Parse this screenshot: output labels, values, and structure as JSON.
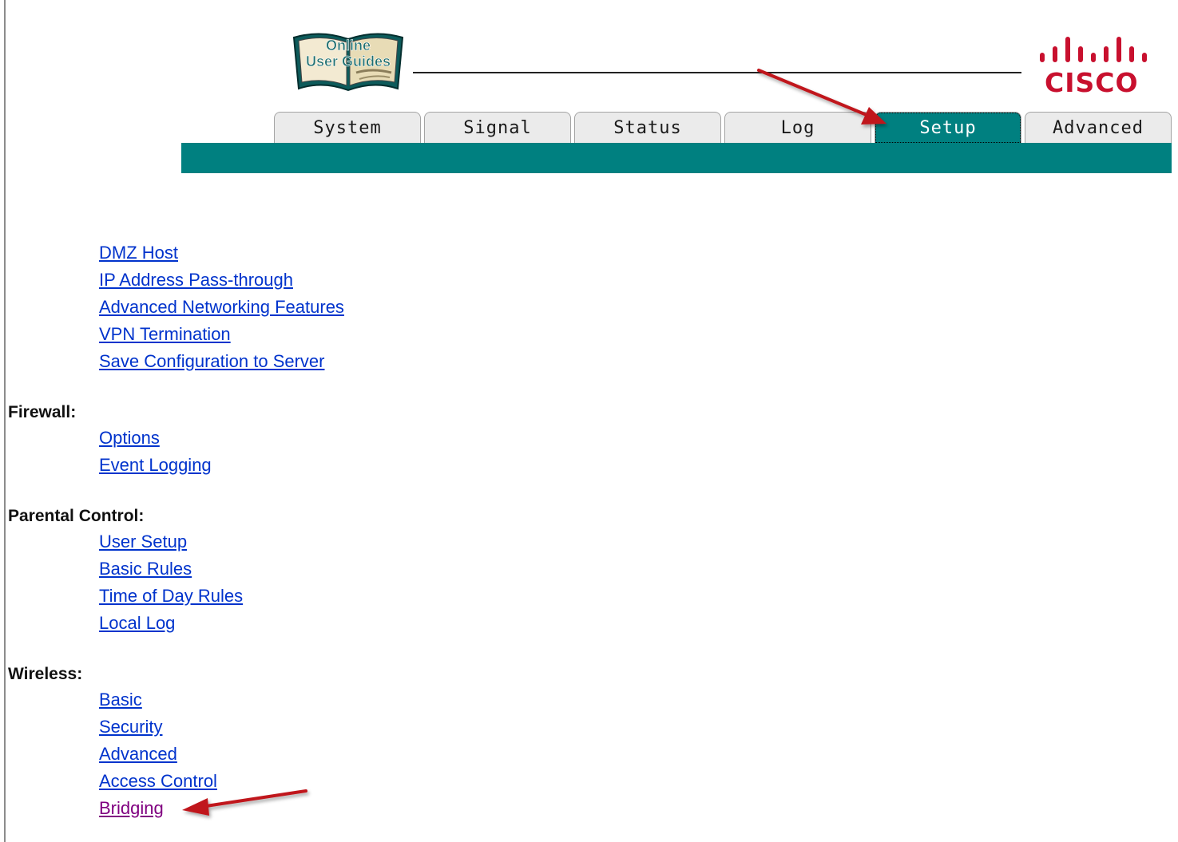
{
  "logo": {
    "guide_line1": "Online",
    "guide_line2": "User Guides",
    "brand": "CISCO"
  },
  "tabs": [
    {
      "label": "System",
      "active": false
    },
    {
      "label": "Signal",
      "active": false
    },
    {
      "label": "Status",
      "active": false
    },
    {
      "label": "Log",
      "active": false
    },
    {
      "label": "Setup",
      "active": true
    },
    {
      "label": "Advanced",
      "active": false
    }
  ],
  "colors": {
    "teal": "#008080",
    "link": "#0033cc",
    "visited": "#800080",
    "annotation_arrow": "#c0171c",
    "brand_red": "#c8102e"
  },
  "menu": {
    "top_links": [
      "DMZ Host",
      "IP Address Pass-through",
      "Advanced Networking Features",
      "VPN Termination",
      "Save Configuration to Server"
    ],
    "firewall": {
      "heading": "Firewall:",
      "links": [
        "Options",
        "Event Logging"
      ]
    },
    "parental": {
      "heading": "Parental Control:",
      "links": [
        "User Setup",
        "Basic Rules",
        "Time of Day Rules",
        "Local Log"
      ]
    },
    "wireless": {
      "heading": "Wireless:",
      "links": [
        "Basic",
        "Security",
        "Advanced",
        "Access Control",
        "Bridging"
      ]
    }
  }
}
